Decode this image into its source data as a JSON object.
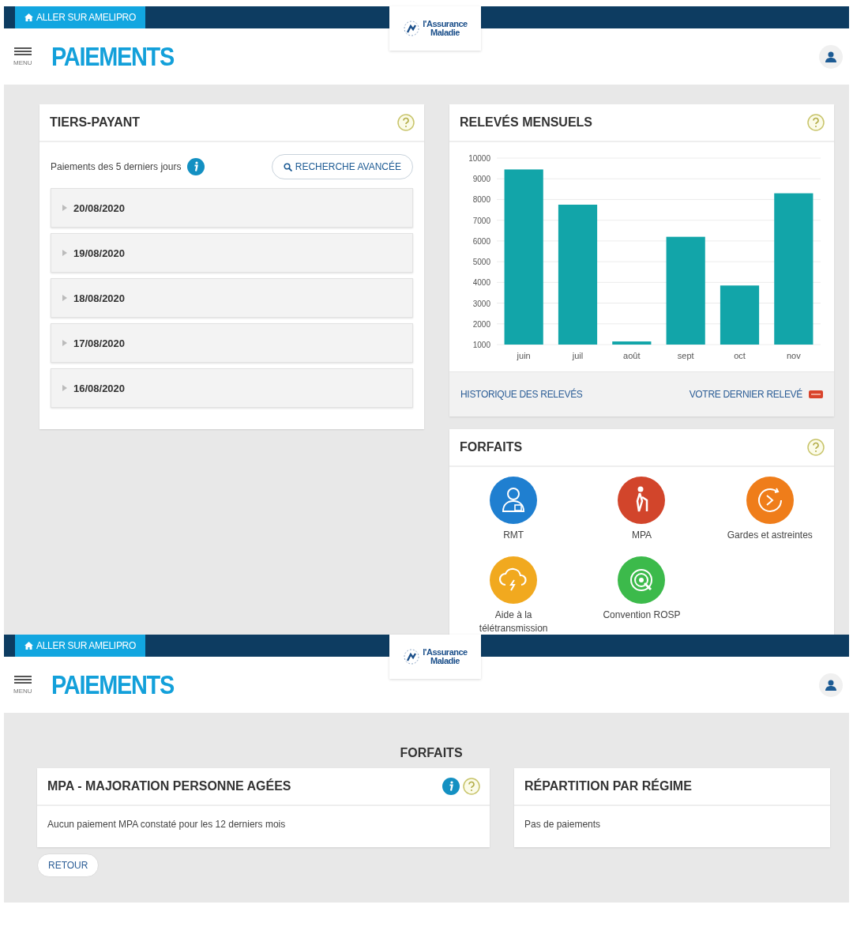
{
  "overview_screen": {
    "top_bar": {
      "link": "ALLER SUR AMELIPRO",
      "logo_lines": [
        "l'Assurance",
        "Maladie"
      ]
    },
    "header": {
      "menu_label": "MENU",
      "title": "PAIEMENTS"
    },
    "tiers_payant": {
      "title": "TIERS-PAYANT",
      "subtitle": "Paiements des 5 derniers jours",
      "search_button": "RECHERCHE AVANCÉE",
      "dates": [
        {
          "label": "20/08/2020",
          "expanded": false
        },
        {
          "label": "19/08/2020",
          "expanded": false
        },
        {
          "label": "18/08/2020",
          "expanded": false
        },
        {
          "label": "17/08/2020",
          "expanded": false
        },
        {
          "label": "16/08/2020",
          "expanded": false
        }
      ]
    },
    "releves": {
      "title": "RELEVÉS MENSUELS",
      "chart_data": {
        "type": "bar",
        "categories": [
          "juin",
          "juil",
          "août",
          "sept",
          "oct",
          "nov"
        ],
        "grid": true,
        "series": [
          {
            "color": "#12a5a9",
            "values": [
              9450,
              7750,
              1150,
              6200,
              3850,
              8300
            ]
          }
        ],
        "ylim": [
          1000,
          10000
        ],
        "yticks": [
          1000,
          2000,
          3000,
          4000,
          5000,
          6000,
          7000,
          8000,
          9000,
          10000
        ]
      },
      "history_link": "HISTORIQUE DES RELEVÉS",
      "last_link": "VOTRE DERNIER RELEVÉ"
    },
    "forfaits": {
      "title": "FORFAITS",
      "items": [
        {
          "label": "RMT",
          "kind": "doctor",
          "color": "#1f7fd0"
        },
        {
          "label": "MPA",
          "kind": "walker",
          "color": "#d2452b"
        },
        {
          "label": "Gardes et astreintes",
          "kind": "clock",
          "color": "#ef7d1a"
        },
        {
          "label": "Aide à la télétransmission",
          "kind": "cloud",
          "color": "#f1a91f"
        },
        {
          "label": "Convention ROSP",
          "kind": "target",
          "color": "#3cba4b"
        }
      ]
    }
  },
  "detail_screen": {
    "top_bar": {
      "link": "ALLER SUR AMELIPRO",
      "logo_lines": [
        "l'Assurance",
        "Maladie"
      ]
    },
    "header": {
      "menu_label": "MENU",
      "title": "PAIEMENTS"
    },
    "section_title": "FORFAITS",
    "mpa_card": {
      "title": "MPA - MAJORATION PERSONNE AGÉES",
      "message": "Aucun paiement MPA constaté pour les 12 derniers mois"
    },
    "regime_card": {
      "title": "RÉPARTITION PAR RÉGIME",
      "message": "Pas de paiements"
    },
    "back_button": "RETOUR"
  }
}
